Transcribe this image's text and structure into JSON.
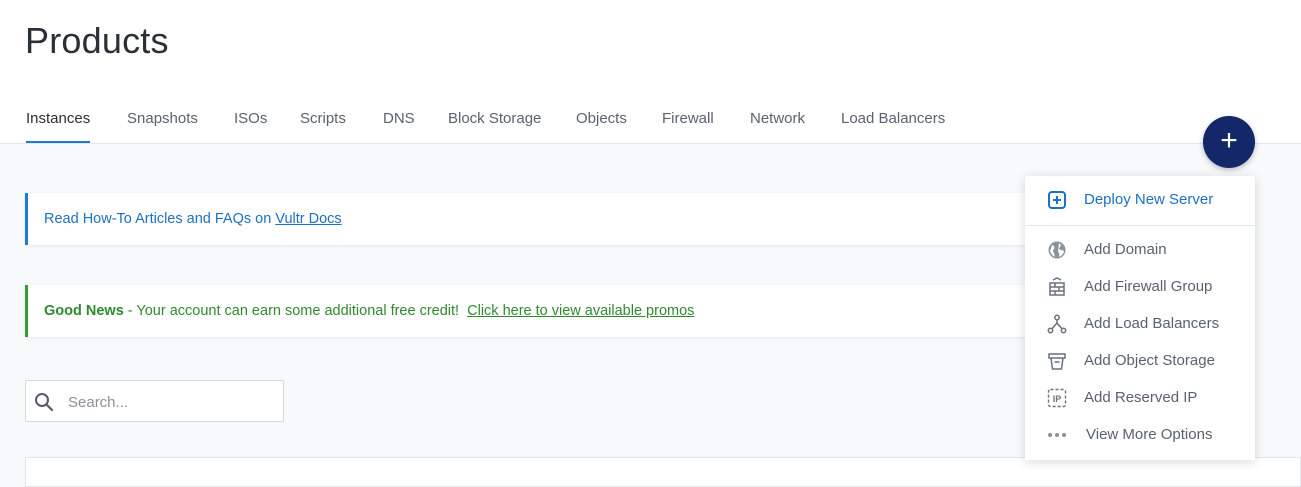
{
  "page": {
    "title": "Products"
  },
  "tabs": [
    {
      "label": "Instances",
      "active": true
    },
    {
      "label": "Snapshots"
    },
    {
      "label": "ISOs"
    },
    {
      "label": "Scripts"
    },
    {
      "label": "DNS"
    },
    {
      "label": "Block Storage"
    },
    {
      "label": "Objects"
    },
    {
      "label": "Firewall"
    },
    {
      "label": "Network"
    },
    {
      "label": "Load Balancers"
    }
  ],
  "fab": {
    "label": "+"
  },
  "info_banner": {
    "text": "Read How-To Articles and FAQs on ",
    "link": "Vultr Docs"
  },
  "good_banner": {
    "bold": "Good News",
    "text": " - Your account can earn some additional free credit!  ",
    "link": "Click here to view available promos"
  },
  "search": {
    "placeholder": "Search..."
  },
  "menu": {
    "items": [
      {
        "label": "Deploy New Server",
        "icon": "plus-square-icon"
      },
      {
        "label": "Add Domain",
        "icon": "globe-icon"
      },
      {
        "label": "Add Firewall Group",
        "icon": "firewall-icon"
      },
      {
        "label": "Add Load Balancers",
        "icon": "load-balancer-icon"
      },
      {
        "label": "Add Object Storage",
        "icon": "object-storage-icon"
      },
      {
        "label": "Add Reserved IP",
        "icon": "reserved-ip-icon"
      },
      {
        "label": "View More Options",
        "icon": "more-dots-icon"
      }
    ]
  },
  "colors": {
    "accent": "#1e7ad6",
    "fab": "#142869",
    "success": "#2f8a2f"
  }
}
